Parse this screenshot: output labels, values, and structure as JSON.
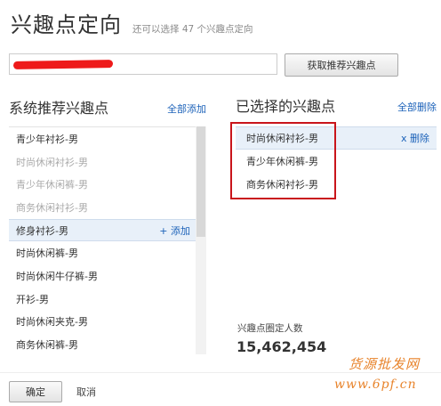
{
  "header": {
    "title": "兴趣点定向",
    "subtitle": "还可以选择 47 个兴趣点定向"
  },
  "search": {
    "value": "",
    "fetch_label": "获取推荐兴趣点"
  },
  "left_panel": {
    "title": "系统推荐兴趣点",
    "add_all_label": "全部添加",
    "items": [
      {
        "label": "青少年衬衫-男",
        "state": "normal"
      },
      {
        "label": "时尚休闲衬衫-男",
        "state": "disabled"
      },
      {
        "label": "青少年休闲裤-男",
        "state": "disabled"
      },
      {
        "label": "商务休闲衬衫-男",
        "state": "disabled"
      },
      {
        "label": "修身衬衫-男",
        "state": "hover",
        "action": "+ 添加"
      },
      {
        "label": "时尚休闲裤-男",
        "state": "normal"
      },
      {
        "label": "时尚休闲牛仔裤-男",
        "state": "normal"
      },
      {
        "label": "开衫-男",
        "state": "normal"
      },
      {
        "label": "时尚休闲夹克-男",
        "state": "normal"
      },
      {
        "label": "商务休闲裤-男",
        "state": "normal"
      }
    ]
  },
  "right_panel": {
    "title": "已选择的兴趣点",
    "remove_all_label": "全部删除",
    "items": [
      {
        "label": "时尚休闲衬衫-男",
        "state": "hover",
        "action": "x 删除"
      },
      {
        "label": "青少年休闲裤-男",
        "state": "normal"
      },
      {
        "label": "商务休闲衬衫-男",
        "state": "normal"
      }
    ],
    "count_label": "兴趣点圈定人数",
    "count_value": "15,462,454"
  },
  "footer": {
    "ok_label": "确定",
    "cancel_label": "取消"
  },
  "watermark": {
    "line1": "货源批发网",
    "line2": "www.6pf.cn"
  },
  "colors": {
    "link": "#1c62b9",
    "highlight_box": "#c9151b",
    "redaction": "#ee1a1a",
    "watermark": "#e8842c"
  }
}
